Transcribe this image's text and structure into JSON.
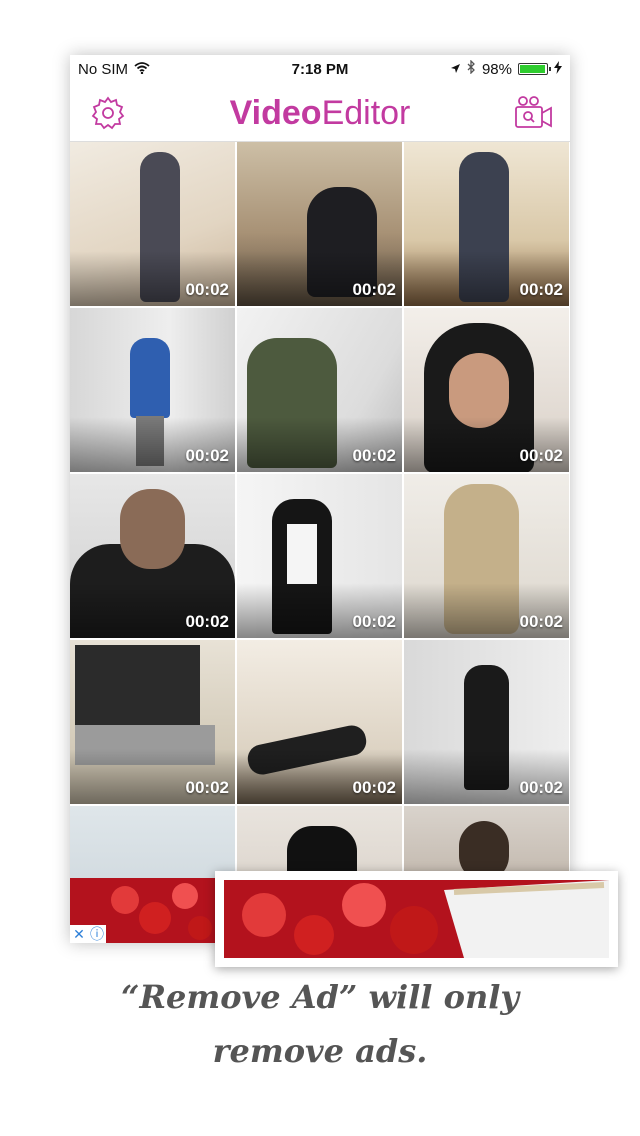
{
  "status_bar": {
    "carrier": "No SIM",
    "time": "7:18 PM",
    "battery_text": "98%",
    "battery_level": 0.98,
    "battery_color": "#2ecc2e"
  },
  "header": {
    "title_bold": "Video",
    "title_regular": "Editor",
    "accent_color": "#c23aa0",
    "left_icon": "gear-icon",
    "right_icon": "video-camera-search-icon"
  },
  "videos": [
    {
      "duration": "00:02"
    },
    {
      "duration": "00:02"
    },
    {
      "duration": "00:02"
    },
    {
      "duration": "00:02"
    },
    {
      "duration": "00:02"
    },
    {
      "duration": "00:02"
    },
    {
      "duration": "00:02"
    },
    {
      "duration": "00:02"
    },
    {
      "duration": "00:02"
    },
    {
      "duration": "00:02"
    },
    {
      "duration": "00:02"
    },
    {
      "duration": "00:02"
    }
  ],
  "ad": {
    "close_icon": "close-icon",
    "info_icon": "info-icon"
  },
  "caption": {
    "line1": "“Remove Ad” will only",
    "line2": "remove ads."
  }
}
